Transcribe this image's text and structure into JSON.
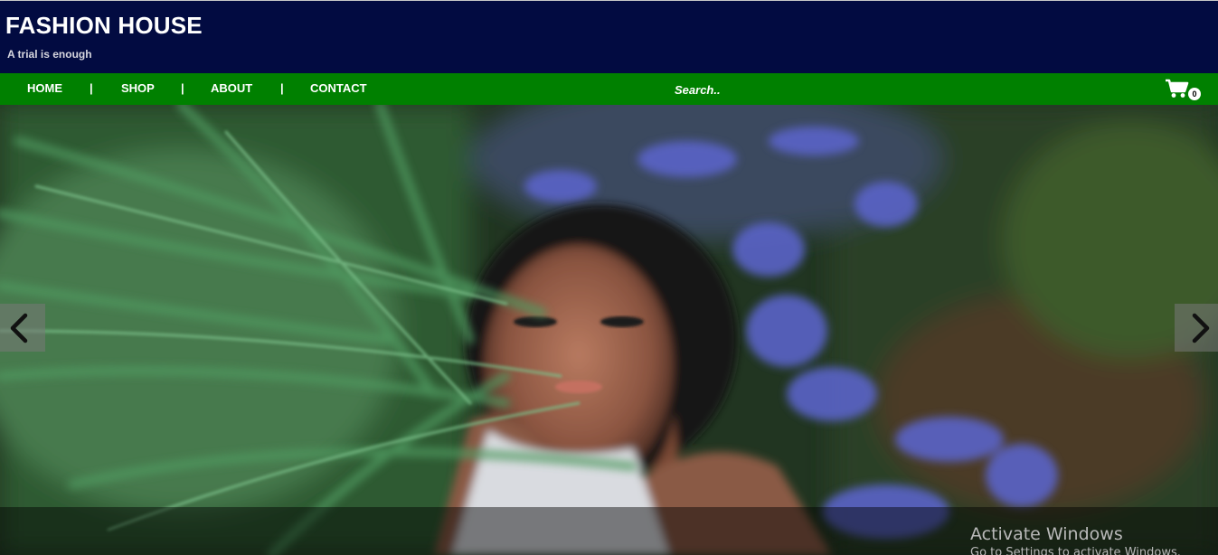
{
  "header": {
    "title": "FASHION HOUSE",
    "tagline": "A trial is enough"
  },
  "nav": {
    "links": [
      "HOME",
      "SHOP",
      "ABOUT",
      "CONTACT"
    ],
    "separator": "|",
    "search_placeholder": "Search..",
    "cart_icon": "shopping-cart-icon",
    "cart_count": "0"
  },
  "slider": {
    "image": "woman-in-grass-and-flowers",
    "prev_icon": "chevron-left-icon",
    "next_icon": "chevron-right-icon"
  },
  "os_watermark": {
    "title": "Activate Windows",
    "subtitle": "Go to Settings to activate Windows."
  },
  "colors": {
    "header_bg": "#020b41",
    "nav_bg": "#008000",
    "text": "#ffffff"
  }
}
